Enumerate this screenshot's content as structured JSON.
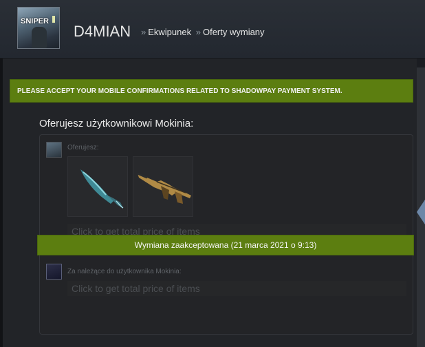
{
  "header": {
    "avatar_logo": "SNIPER",
    "username": "D4MIAN",
    "breadcrumb_separator": "»",
    "breadcrumbs": [
      "Ekwipunek",
      "Oferty wymiany"
    ]
  },
  "notice": {
    "text": "PLEASE ACCEPT YOUR MOBILE CONFIRMATIONS RELATED TO SHADOWPAY PAYMENT SYSTEM."
  },
  "trade": {
    "heading": "Oferujesz użytkownikowi Mokinia:",
    "my_side_label": "Oferujesz:",
    "their_side_label": "Za należące do użytkownika Mokinia:",
    "price_placeholder": "Click to get total price of items",
    "accepted_text": "Wymiana zaakceptowana (21 marca 2021 o 9:13)",
    "items": [
      {
        "icon": "knife-icon"
      },
      {
        "icon": "rifle-icon"
      }
    ]
  },
  "colors": {
    "accent_green": "#5c7e10",
    "background": "#1b1d22"
  }
}
